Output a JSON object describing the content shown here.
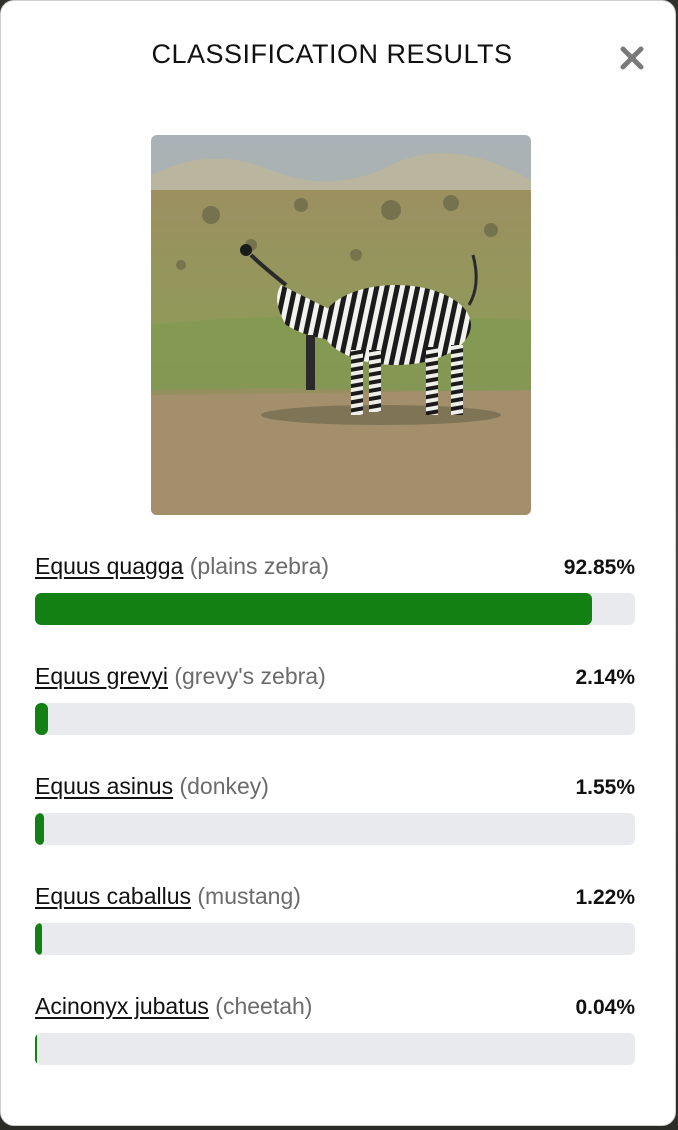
{
  "modal": {
    "title": "CLASSIFICATION RESULTS",
    "close_icon": "close-x-icon"
  },
  "image": {
    "subject": "zebra in grassland"
  },
  "colors": {
    "bar_fill": "#128013",
    "bar_track": "#e8eaed",
    "common_name": "#6b6b6b"
  },
  "results": [
    {
      "scientific": "Equus quagga",
      "common": "(plains zebra)",
      "percent_text": "92.85%",
      "fraction": 0.9285
    },
    {
      "scientific": "Equus grevyi",
      "common": "(grevy's zebra)",
      "percent_text": "2.14%",
      "fraction": 0.0214
    },
    {
      "scientific": "Equus asinus",
      "common": "(donkey)",
      "percent_text": "1.55%",
      "fraction": 0.0155
    },
    {
      "scientific": "Equus caballus",
      "common": "(mustang)",
      "percent_text": "1.22%",
      "fraction": 0.0122
    },
    {
      "scientific": "Acinonyx jubatus",
      "common": "(cheetah)",
      "percent_text": "0.04%",
      "fraction": 0.0004
    }
  ]
}
